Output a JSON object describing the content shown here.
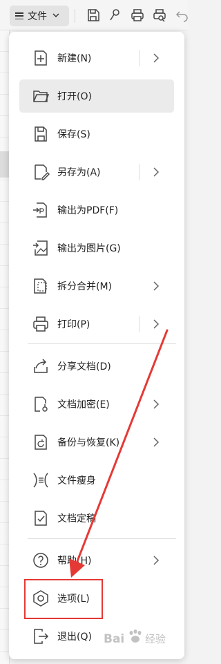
{
  "toolbar": {
    "file_label": "文件",
    "icons": [
      "hamburger-icon",
      "chevron-down-icon",
      "save-icon",
      "brush-icon",
      "print-icon",
      "print-preview-icon",
      "undo-icon"
    ]
  },
  "menu": {
    "items": [
      {
        "label": "新建(N)",
        "icon": "new-file-icon",
        "has_submenu": true
      },
      {
        "label": "打开(O)",
        "icon": "folder-open-icon",
        "has_submenu": false,
        "active": true
      },
      {
        "label": "保存(S)",
        "icon": "save-icon",
        "has_submenu": false
      },
      {
        "label": "另存为(A)",
        "icon": "save-as-icon",
        "has_submenu": true
      },
      {
        "label": "输出为PDF(F)",
        "icon": "export-pdf-icon",
        "has_submenu": false
      },
      {
        "label": "输出为图片(G)",
        "icon": "export-image-icon",
        "has_submenu": false
      },
      {
        "label": "拆分合并(M)",
        "icon": "split-merge-icon",
        "has_submenu": true
      },
      {
        "label": "打印(P)",
        "icon": "print-icon",
        "has_submenu": true
      },
      {
        "label": "分享文档(D)",
        "icon": "share-icon",
        "has_submenu": false
      },
      {
        "label": "文档加密(E)",
        "icon": "encrypt-icon",
        "has_submenu": true
      },
      {
        "label": "备份与恢复(K)",
        "icon": "backup-icon",
        "has_submenu": true
      },
      {
        "label": "文件瘦身",
        "icon": "slim-file-icon",
        "has_submenu": false
      },
      {
        "label": "文档定稿",
        "icon": "finalize-icon",
        "has_submenu": false
      },
      {
        "label": "帮助(H)",
        "icon": "help-icon",
        "has_submenu": true
      },
      {
        "label": "选项(L)",
        "icon": "options-hexagon-icon",
        "has_submenu": false,
        "highlighted": true
      },
      {
        "label": "退出(Q)",
        "icon": "exit-icon",
        "has_submenu": false
      }
    ]
  },
  "annotation": {
    "highlight_color": "#e53935",
    "target": "选项(L)"
  },
  "watermark": {
    "text": "Bai 经验"
  }
}
